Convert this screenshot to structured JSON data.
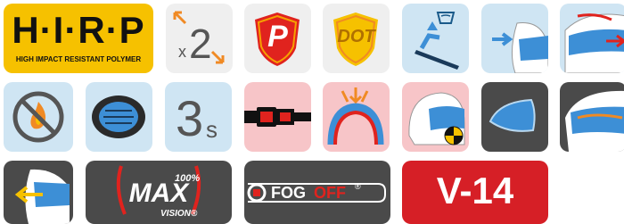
{
  "icons": {
    "hirp": {
      "letters": "H·I·R·P",
      "caption": "HIGH IMPACT RESISTANT POLYMER",
      "icon": "hirp-badge"
    },
    "shell_sizes": {
      "prefix": "x",
      "value": "2",
      "icon": "double-arrow-resize"
    },
    "p_shield": {
      "letter": "P",
      "icon": "p-shield-badge"
    },
    "dot_shield": {
      "label": "DOT",
      "icon": "dot-shield-badge"
    },
    "washable": {
      "icon": "washable-liner"
    },
    "visor_ventilation": {
      "icon": "visor-airflow"
    },
    "helmet_airflow": {
      "icon": "helmet-airflow"
    },
    "no_fire": {
      "icon": "no-fire"
    },
    "liner": {
      "icon": "comfort-liner"
    },
    "three_s": {
      "value": "3",
      "suffix": "s",
      "icon": "three-seconds"
    },
    "strap": {
      "icon": "chin-strap-buckle"
    },
    "impact": {
      "icon": "impact-absorption"
    },
    "helmet_center": {
      "icon": "helmet-center-of-gravity"
    },
    "visor_tinted": {
      "icon": "tinted-visor"
    },
    "visor_helmet_side": {
      "icon": "helmet-visor-side"
    },
    "helmet_visor_front": {
      "icon": "helmet-visor-arrow"
    },
    "max_vision": {
      "top": "100%",
      "main": "MAX",
      "bottom": "VISION®",
      "icon": "max-vision-logo"
    },
    "fogoff": {
      "label_a": "FOG",
      "label_b": "OFF",
      "mark": "®",
      "icon": "fogoff-logo"
    },
    "v14": {
      "label": "V-14"
    }
  },
  "colors": {
    "yellow": "#f6c100",
    "light_gray": "#efefef",
    "light_blue": "#cfe5f3",
    "pink": "#f7c5c8",
    "dark_gray": "#4a4a4a",
    "red": "#d61f26",
    "orange": "#f08a24",
    "blue": "#3d8fd6"
  }
}
